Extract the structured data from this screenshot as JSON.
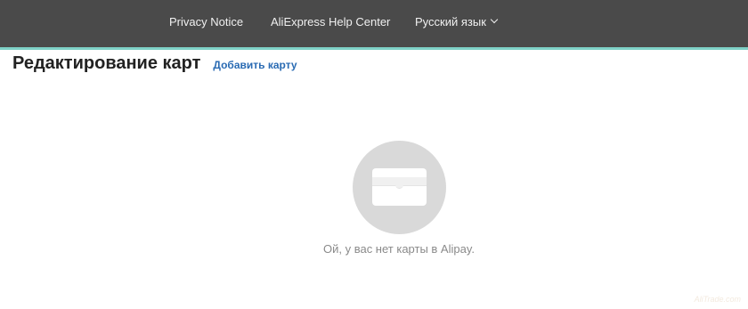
{
  "header": {
    "nav": [
      {
        "label": "Privacy Notice"
      },
      {
        "label": "AliExpress Help Center"
      },
      {
        "label": "Русский язык",
        "icon": "chevron-down-icon"
      }
    ],
    "accent_color": "#7fd1c7",
    "background_color": "#4a4a4a"
  },
  "main": {
    "title": "Редактирование карт",
    "add_card_label": "Добавить карту",
    "empty_state": {
      "icon": "card-icon",
      "message": "Ой, у вас нет карты в Alipay."
    }
  },
  "watermark": "AliTrade.com",
  "colors": {
    "link": "#2a6bb3",
    "empty_circle": "#d9d9d9"
  }
}
